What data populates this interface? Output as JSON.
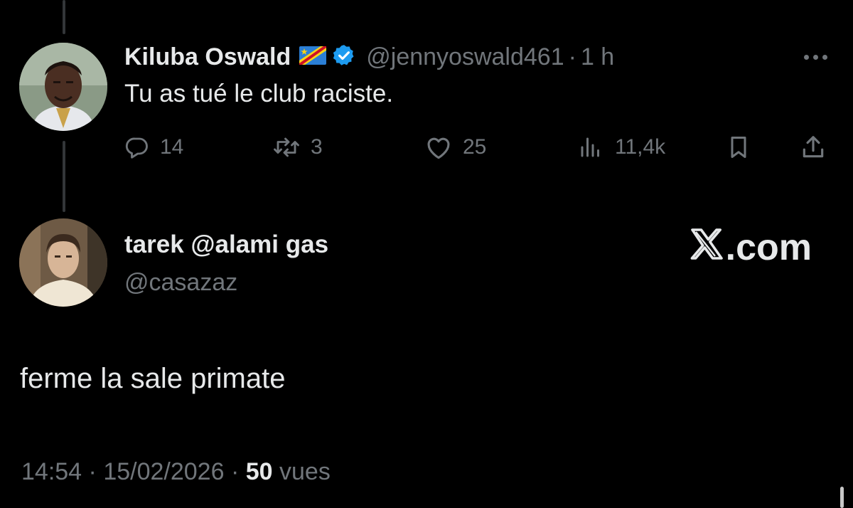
{
  "tweet": {
    "author_name": "Kiluba Oswald",
    "author_handle": "@jennyoswald461",
    "separator": "·",
    "time": "1 h",
    "text": "Tu as tué le club raciste.",
    "icons": {
      "flag": "drc-flag-icon",
      "verified": "verified-badge-icon",
      "more": "more-icon"
    },
    "stats": {
      "replies": "14",
      "reposts": "3",
      "likes": "25",
      "views": "11,4k"
    },
    "accent": "#1d9bf0"
  },
  "reply": {
    "author_name": "tarek @alami gas",
    "author_handle": "@casazaz",
    "watermark": ".com",
    "text": "ferme la sale primate",
    "time": "14:54",
    "separator": "·",
    "date": "15/02/2026",
    "views_count": "50",
    "views_label": "vues"
  },
  "colors": {
    "background": "#000000",
    "text_primary": "#e7e9ea",
    "text_secondary": "#71767b",
    "thread_line": "#333639"
  }
}
